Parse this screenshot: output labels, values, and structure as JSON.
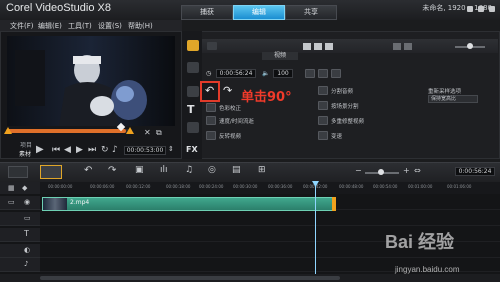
{
  "app": {
    "title": "Corel VideoStudio X8",
    "project": "未命名, 1920 x 1080"
  },
  "tabs": [
    {
      "label": "捕获",
      "active": false
    },
    {
      "label": "编辑",
      "active": true
    },
    {
      "label": "共享",
      "active": false
    }
  ],
  "menu": [
    "文件(F)",
    "编辑(E)",
    "工具(T)",
    "设置(S)",
    "帮助(H)"
  ],
  "player": {
    "mode_project": "项目",
    "mode_clip": "素材",
    "timecode": "00:00:53:00",
    "scrub_progress": 0.95
  },
  "options": {
    "tab": "视频",
    "clip_duration": "0:00:56:24",
    "volume": "100",
    "items": [
      {
        "label": "色彩校正"
      },
      {
        "label": "重新采样"
      },
      {
        "label": "速度/时间流逝"
      },
      {
        "label": "分割音频"
      },
      {
        "label": "按场景分割"
      },
      {
        "label": "多重修整视频"
      },
      {
        "label": "反转视频"
      },
      {
        "label": "变速"
      }
    ],
    "resample_label": "重新采样选项",
    "resample_value": "保持宽高比"
  },
  "annotation": "单击90°",
  "timeline": {
    "clip_name": "2.mp4",
    "timecode": "0:00:56:24",
    "ruler": [
      "00:00:00:00",
      "00:00:06:00",
      "00:00:12:00",
      "00:00:18:00",
      "00:00:24:00",
      "00:00:30:00",
      "00:00:36:00",
      "00:00:42:00",
      "00:00:48:00",
      "00:00:54:00",
      "00:01:00:00",
      "00:01:06:00"
    ]
  },
  "watermark": {
    "brand": "Bai 经验",
    "url": "jingyan.baidu.com"
  }
}
